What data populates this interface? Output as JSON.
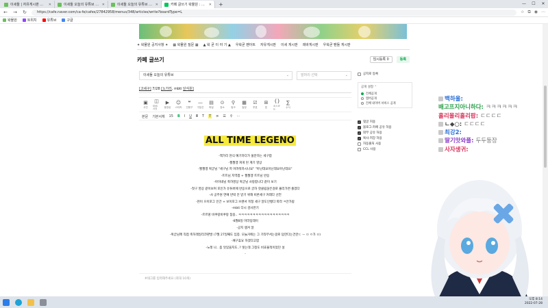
{
  "browser": {
    "tabs": [
      {
        "label": "이세돌 | 자유게시판 왁물원",
        "fav": "#6cbf5f",
        "active": false
      },
      {
        "label": "이세돌 오늘의 유튜브 왁물원",
        "fav": "#6cbf5f",
        "active": false
      },
      {
        "label": "이세돌 오늘의 유튜브 - 왁물원",
        "fav": "#6cbf5f",
        "active": false
      },
      {
        "label": "카페 글쓰기 왁물원 : 공방 게시",
        "fav": "#03c75a",
        "active": true
      }
    ],
    "new_tab": "+",
    "url": "https://cafe.naver.com/ca-fe/cafes/27842958/menus/348/articles/write?boardType=L",
    "bookmarks": [
      {
        "label": "왁물원",
        "color": "#6cbf5f"
      },
      {
        "label": "트위치",
        "color": "#9146ff"
      },
      {
        "label": "유튜브",
        "color": "#ff0000"
      },
      {
        "label": "구글",
        "color": "#4285f4"
      }
    ]
  },
  "cafe": {
    "menu": [
      "✦ 왁물원 공지사항 ✦",
      "▦ 왁물원 질문 ▦",
      "▲ 왁 굳 이 야 기 ▲",
      "우왁굳 팬아트",
      "자유게시판",
      "이세 게시판",
      "레바게시판",
      "우왁굳 팬들 게시판"
    ],
    "editor_title": "카페 글쓰기",
    "temp_save": "임시등록",
    "temp_count": "0",
    "register": "등록",
    "board_select": "이세돌 오늘의 유튜브",
    "head_select": "말머리 선택",
    "post_title_prefix": "[고세구]",
    "post_title_mid": " 7/28 ",
    "post_title_link1": "[노가리",
    "post_title_sep": ", mbti ",
    "post_title_link2": "단식원]",
    "tools": [
      {
        "label": "사진",
        "icon": "▣"
      },
      {
        "label": "SNS 사진",
        "icon": "◫"
      },
      {
        "label": "동영상",
        "icon": "▶"
      },
      {
        "label": "스티커",
        "icon": "☺"
      },
      {
        "label": "인용구",
        "icon": "❝"
      },
      {
        "label": "구분선",
        "icon": "—"
      },
      {
        "label": "파일",
        "icon": "▤"
      },
      {
        "label": "장소",
        "icon": "⊙"
      },
      {
        "label": "링크",
        "icon": "⚲"
      },
      {
        "label": "일정",
        "icon": "▦"
      },
      {
        "label": "투표",
        "icon": "☑"
      },
      {
        "label": "표",
        "icon": "⊞"
      },
      {
        "label": "소스코드",
        "icon": "{}"
      },
      {
        "label": "수식",
        "icon": "∑"
      }
    ],
    "format": {
      "style": "본문",
      "font": "기본서체",
      "size": "15",
      "bold": "B",
      "italic": "I",
      "underline": "U",
      "strike": "T",
      "color": "T",
      "highlight": "T"
    },
    "big_title": "ALL TIME LEGENO",
    "body_lines": [
      "-책가리 현식 예기하다가 울분하는 세구팝",
      "-월월맹 쳐게 된 계기 영상",
      "-월월맹 왁굳님 \"세구님 저 어려워하시나요\" \"아닌데요아닌데요아닌데요\"",
      "-트트님 지역팝 + 월월맹 트트님 반응",
      "-아이네님 축하영상 왁굳님 사랑합니다 같이 보기",
      "-첫구 영상 같이보며 포인가 유튜버에 반응으로 긁하 핫클립끊은걸로 몰리가면 졸겠다",
      "-사 공주원 연예 반박 안 받기 위해 비른세구 커레다 선언",
      "-현이 으이포그 인간 + 보이포그 브랜서 목청 세구 알도인뱅다 따라 ㅋ안가람",
      "-mbti 다시 검사한기",
      "-르르땅 비쿠랑비쿠랑 참송.. ㅋㅋㅋㅋㅋㅋㅋㅋㅋㅋㅋㅋㅋㅋㅋㅋㅋㅋ",
      "-8월8일 마라탕데이",
      "-공지 챙겨 알",
      "-왁굳님께 직접 축하래일리코판발 (7월 27일째도 임종. 오늘거에는 그 기타부서는걸로 답한다는건만ㄷ ㅡ ㅁ ㅇ가 ㅁ)",
      "-패구휴요 하겠다고함",
      "-노래 나.. 좀 맛있을지도..? 렛는데 그정도 비효율적이었던 설",
      "-"
    ],
    "tag_placeholder": "#태그를 입력해주세요 (최대 10개)",
    "side": {
      "notice": "공지로 등록",
      "public_label": "공개 설정",
      "radios": [
        {
          "label": "전체공개",
          "on": true
        },
        {
          "label": "멤버공개",
          "on": false
        },
        {
          "label": "전체 네이버 서비스 공개",
          "on": false
        }
      ],
      "options": [
        {
          "label": "댓글 허용",
          "on": true
        },
        {
          "label": "블로그·카페 공유 허용",
          "on": true
        },
        {
          "label": "외부 공유 허용",
          "on": true
        },
        {
          "label": "복사·저장 허용",
          "on": true
        },
        {
          "label": "자동출처 사용",
          "on": false
        },
        {
          "label": "CCL 사용",
          "on": false
        }
      ]
    }
  },
  "chat": [
    {
      "user": "백하울:",
      "msg": "",
      "color": "#2a6fd6",
      "icon": true
    },
    {
      "user": "배고프지아니하다:",
      "msg": "ㅋㅋㅋㅋㅋㅋ",
      "color": "#2a9d4a",
      "icon": false
    },
    {
      "user": "홀리몰리홀리팝:",
      "msg": "ㄷㄷㄷㄷ",
      "color": "#d8325a",
      "icon": false
    },
    {
      "user": "ㄴ◆○:",
      "msg": "ㄷㄷㄷㄷ",
      "color": "#444444",
      "icon": true
    },
    {
      "user": "최강2:",
      "msg": "",
      "color": "#2a6fd6",
      "icon": true
    },
    {
      "user": "딸기맛와플:",
      "msg": "두두둥장",
      "color": "#8a3fc8",
      "icon": true
    },
    {
      "user": "사자생귀:",
      "msg": "",
      "color": "#d8325a",
      "icon": true
    }
  ],
  "taskbar": {
    "time": "오후 8:14",
    "date": "2022-07-28"
  }
}
